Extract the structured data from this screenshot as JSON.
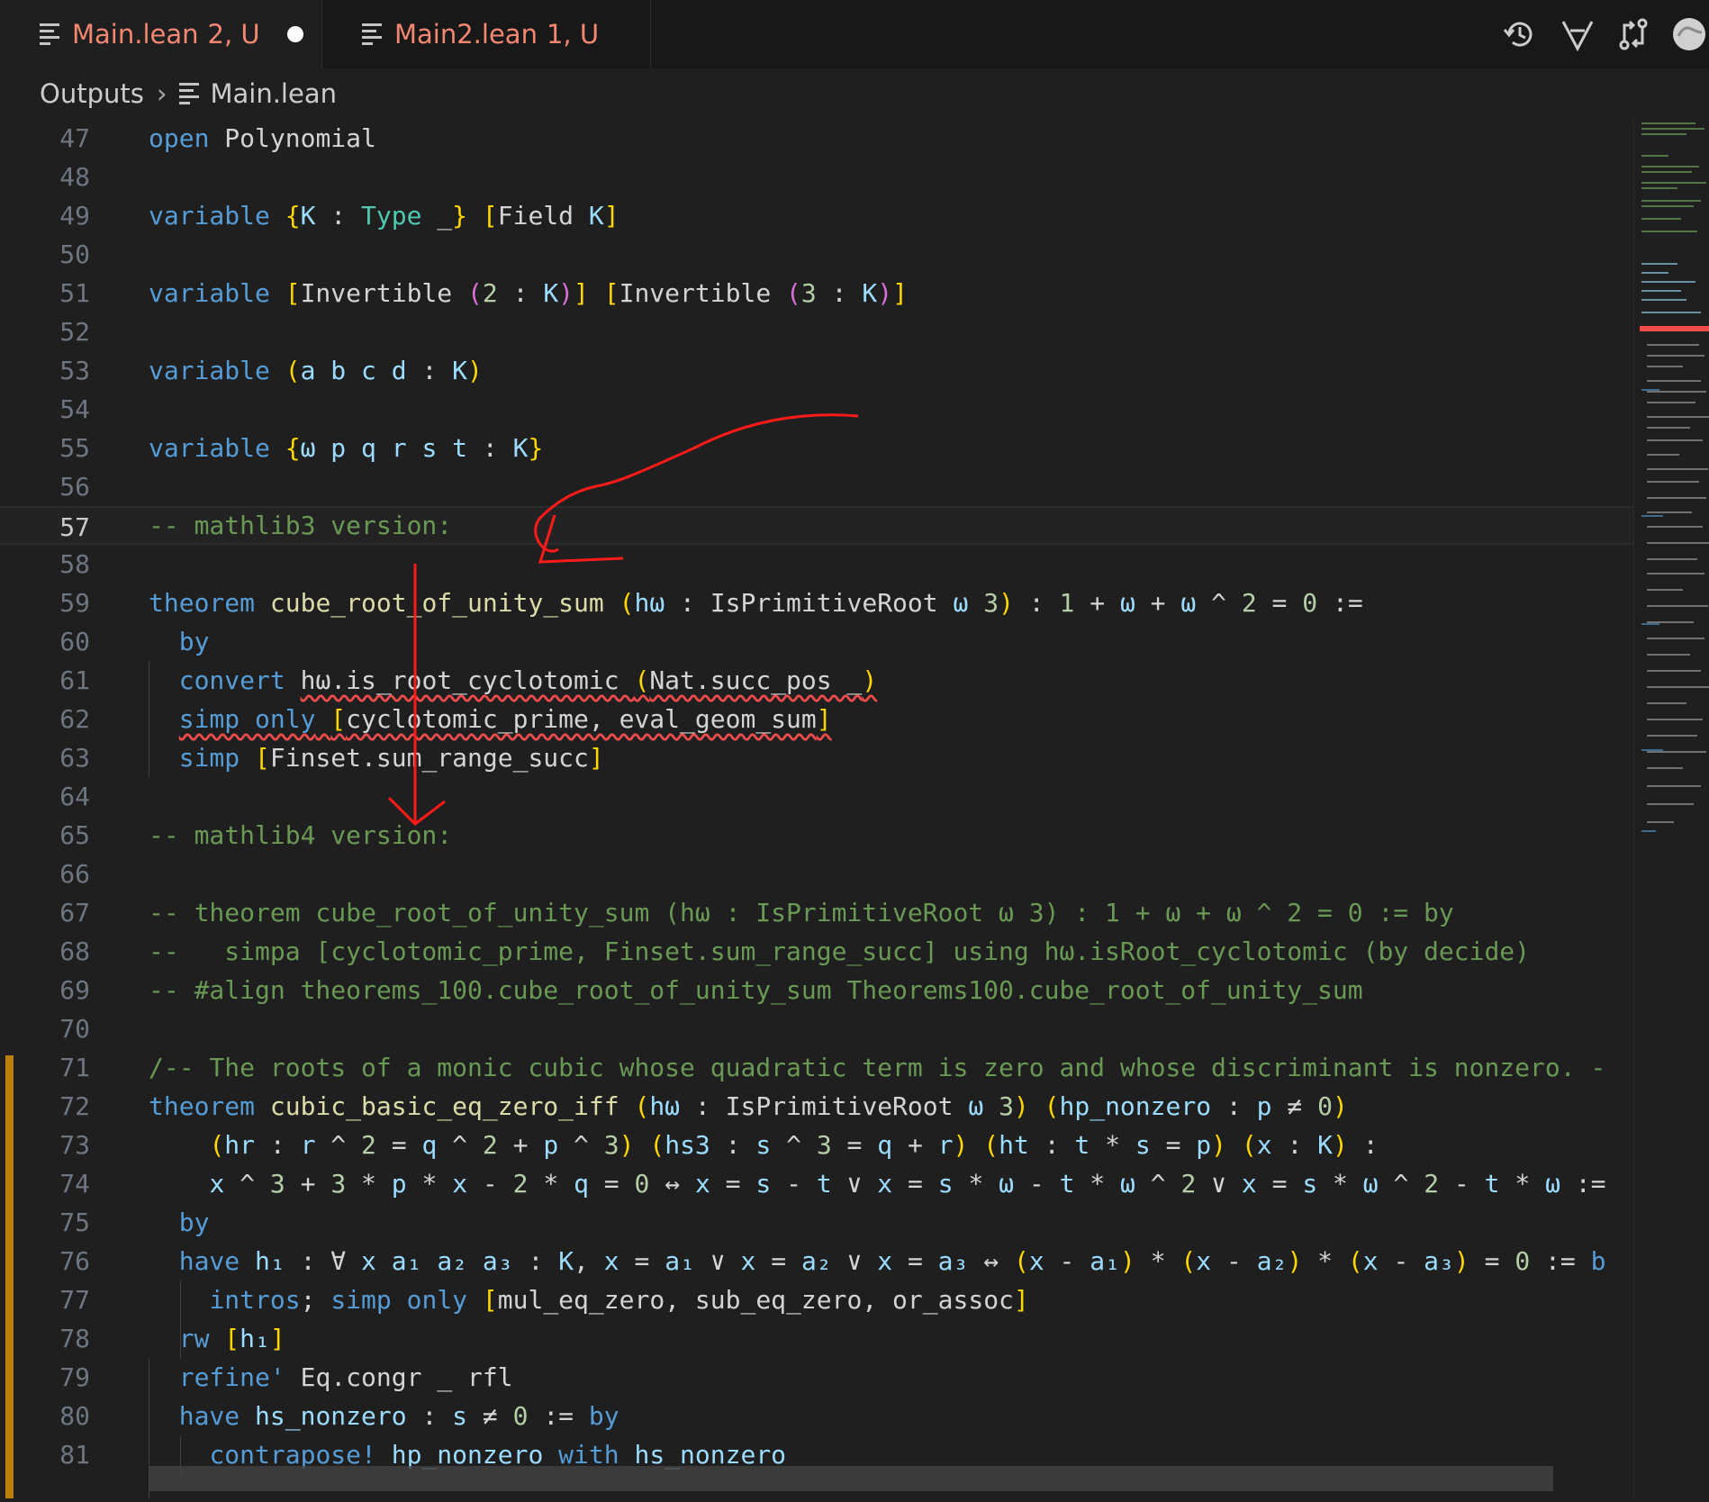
{
  "tabs": [
    {
      "name": "Main.lean",
      "status": "2, U",
      "dirty": true,
      "active": true
    },
    {
      "name": "Main2.lean",
      "status": "1, U",
      "dirty": false,
      "active": false
    }
  ],
  "toolbar": {
    "icons": [
      "history-icon",
      "filter-icon",
      "compare-icon",
      "avatar-icon"
    ]
  },
  "breadcrumb": {
    "root": "Outputs",
    "file": "Main.lean"
  },
  "editor": {
    "current_line": 57,
    "lines": [
      {
        "n": "47",
        "text": "open Polynomial"
      },
      {
        "n": "48",
        "text": ""
      },
      {
        "n": "49",
        "text": "variable {K : Type _} [Field K]"
      },
      {
        "n": "50",
        "text": ""
      },
      {
        "n": "51",
        "text": "variable [Invertible (2 : K)] [Invertible (3 : K)]"
      },
      {
        "n": "52",
        "text": ""
      },
      {
        "n": "53",
        "text": "variable (a b c d : K)"
      },
      {
        "n": "54",
        "text": ""
      },
      {
        "n": "55",
        "text": "variable {ω p q r s t : K}"
      },
      {
        "n": "56",
        "text": ""
      },
      {
        "n": "57",
        "text": "-- mathlib3 version:"
      },
      {
        "n": "58",
        "text": ""
      },
      {
        "n": "59",
        "text": "theorem cube_root_of_unity_sum (hω : IsPrimitiveRoot ω 3) : 1 + ω + ω ^ 2 = 0 :="
      },
      {
        "n": "60",
        "text": "  by"
      },
      {
        "n": "61",
        "text": "  convert hω.is_root_cyclotomic (Nat.succ_pos _)"
      },
      {
        "n": "62",
        "text": "  simp only [cyclotomic_prime, eval_geom_sum]"
      },
      {
        "n": "63",
        "text": "  simp [Finset.sum_range_succ]"
      },
      {
        "n": "64",
        "text": ""
      },
      {
        "n": "65",
        "text": "-- mathlib4 version:"
      },
      {
        "n": "66",
        "text": ""
      },
      {
        "n": "67",
        "text": "-- theorem cube_root_of_unity_sum (hω : IsPrimitiveRoot ω 3) : 1 + ω + ω ^ 2 = 0 := by"
      },
      {
        "n": "68",
        "text": "--   simpa [cyclotomic_prime, Finset.sum_range_succ] using hω.isRoot_cyclotomic (by decide)"
      },
      {
        "n": "69",
        "text": "-- #align theorems_100.cube_root_of_unity_sum Theorems100.cube_root_of_unity_sum"
      },
      {
        "n": "70",
        "text": ""
      },
      {
        "n": "71",
        "text": "/-- The roots of a monic cubic whose quadratic term is zero and whose discriminant is nonzero. -"
      },
      {
        "n": "72",
        "text": "theorem cubic_basic_eq_zero_iff (hω : IsPrimitiveRoot ω 3) (hp_nonzero : p ≠ 0)"
      },
      {
        "n": "73",
        "text": "    (hr : r ^ 2 = q ^ 2 + p ^ 3) (hs3 : s ^ 3 = q + r) (ht : t * s = p) (x : K) :"
      },
      {
        "n": "74",
        "text": "    x ^ 3 + 3 * p * x - 2 * q = 0 ↔ x = s - t ∨ x = s * ω - t * ω ^ 2 ∨ x = s * ω ^ 2 - t * ω :="
      },
      {
        "n": "75",
        "text": "  by"
      },
      {
        "n": "76",
        "text": "  have h₁ : ∀ x a₁ a₂ a₃ : K, x = a₁ ∨ x = a₂ ∨ x = a₃ ↔ (x - a₁) * (x - a₂) * (x - a₃) = 0 := b"
      },
      {
        "n": "77",
        "text": "    intros; simp only [mul_eq_zero, sub_eq_zero, or_assoc]"
      },
      {
        "n": "78",
        "text": "  rw [h₁]"
      },
      {
        "n": "79",
        "text": "  refine' Eq.congr _ rfl"
      },
      {
        "n": "80",
        "text": "  have hs_nonzero : s ≠ 0 := by"
      },
      {
        "n": "81",
        "text": "    contrapose! hp_nonzero with hs_nonzero"
      }
    ]
  },
  "colors": {
    "background": "#1f1f1f",
    "keyword": "#569cd6",
    "type": "#4ec9b0",
    "variable": "#9cdcfe",
    "function": "#dcdcaa",
    "number": "#b5cea8",
    "comment": "#6a9955",
    "bracket1": "#ffd700",
    "bracket2": "#da70d6",
    "bracket3": "#179fff",
    "error_squiggle": "#f14c4c",
    "tab_modified": "#f48771",
    "annotation": "#ff0000"
  }
}
